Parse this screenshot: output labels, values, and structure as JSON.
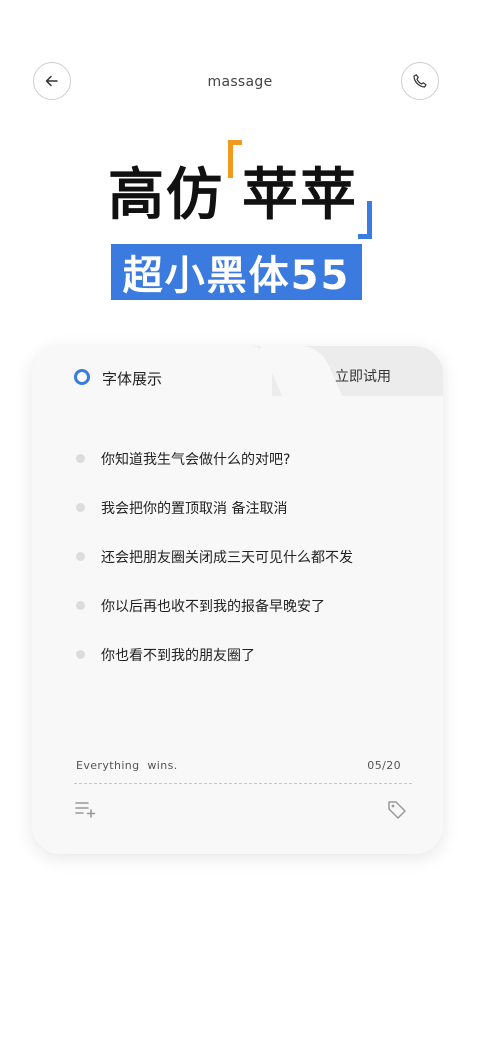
{
  "header": {
    "title": "massage",
    "back_icon": "arrow-left-icon",
    "phone_icon": "phone-icon"
  },
  "hero": {
    "line1_prefix": "高仿",
    "line1_bracketed": "苹苹",
    "line2": "超小黑体55",
    "accent_orange": "#f29a1d",
    "accent_blue": "#3b7be0"
  },
  "card": {
    "active_tab": "字体展示",
    "inactive_tab": "立即试用",
    "items": [
      "你知道我生气会做什么的对吧?",
      "我会把你的置顶取消  备注取消",
      "还会把朋友圈关闭成三天可见什么都不发",
      "你以后再也收不到我的报备早晚安了",
      "你也看不到我的朋友圈了"
    ],
    "footer_text": "Everything  wins.",
    "footer_count": "05/20",
    "list_add_icon": "playlist-add-icon",
    "tag_icon": "tag-icon"
  }
}
